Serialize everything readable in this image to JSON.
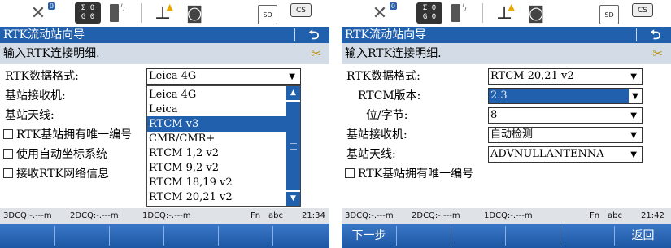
{
  "left_screen": {
    "status": {
      "sat_badge": "0",
      "sigma_top": "Σ 0",
      "sigma_bottom": "G 0",
      "sd_label": "SD",
      "cs_label": "CS"
    },
    "title": "RTK流动站向导",
    "back_icon": "⮌",
    "subtitle": "输入RTK连接明细.",
    "fields": {
      "format_label": "RTK数据格式:",
      "format_value": "Leica 4G",
      "receiver_label": "基站接收机:",
      "antenna_label": "基站天线:"
    },
    "checkboxes": [
      "RTK基站拥有唯一编号",
      "使用自动坐标系统",
      "接收RTK网络信息"
    ],
    "dropdown_options": [
      "Leica 4G",
      "Leica",
      "RTCM v3",
      "CMR/CMR+",
      "RTCM 1,2 v2",
      "RTCM 9,2 v2",
      "RTCM 18,19 v2",
      "RTCM 20,21 v2"
    ],
    "dropdown_selected": "RTCM v3",
    "infobar": {
      "q1": "3DCQ:-.---m",
      "q2": "2DCQ:-.---m",
      "q3": "1DCQ:-.---m",
      "fn": "Fn",
      "abc": "abc",
      "time": "21:34"
    },
    "fkeys": [
      "",
      "",
      "",
      "",
      "",
      ""
    ]
  },
  "right_screen": {
    "status": {
      "sat_badge": "0",
      "sigma_top": "Σ 0",
      "sigma_bottom": "G 0",
      "sd_label": "SD",
      "cs_label": "CS"
    },
    "title": "RTK流动站向导",
    "back_icon": "⮌",
    "subtitle": "输入RTK连接明细.",
    "fields": {
      "format_label": "RTK数据格式:",
      "format_value": "RTCM 20,21 v2",
      "version_label": "RTCM版本:",
      "version_value": "2.3",
      "bits_label": "位/字节:",
      "bits_value": "8",
      "receiver_label": "基站接收机:",
      "receiver_value": "自动检测",
      "antenna_label": "基站天线:",
      "antenna_value": "ADVNULLANTENNA"
    },
    "checkboxes": [
      "RTK基站拥有唯一编号"
    ],
    "infobar": {
      "q1": "3DCQ:-.---m",
      "q2": "2DCQ:-.---m",
      "q3": "1DCQ:-.---m",
      "fn": "Fn",
      "abc": "abc",
      "time": "21:42"
    },
    "fkeys": [
      "下一步",
      "",
      "",
      "",
      "",
      "返回"
    ]
  },
  "icons": {
    "satellite": "satellite-icon",
    "sigma": "sigma-status-icon",
    "battery": "battery-icon",
    "rover": "rover-antenna-icon",
    "camera": "camera-icon",
    "sd": "sd-card-icon",
    "cs": "cs-controller-icon",
    "tool": "tool-icon"
  }
}
